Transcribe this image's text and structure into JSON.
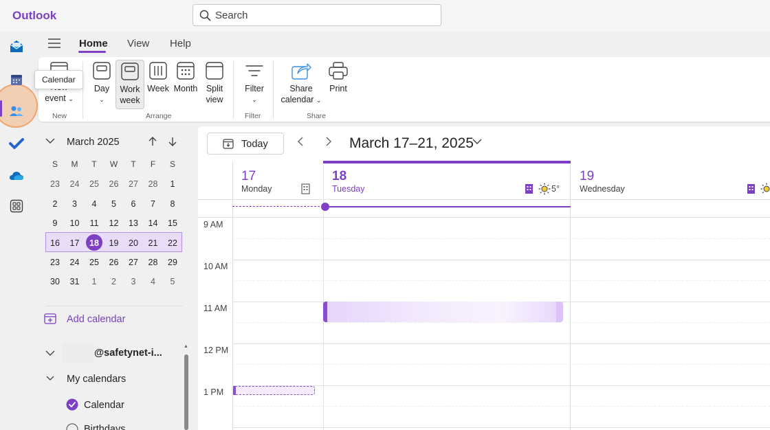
{
  "app": {
    "title": "Outlook"
  },
  "search": {
    "placeholder": "Search"
  },
  "rail": {
    "items": [
      "mail-icon",
      "calendar-icon",
      "people-icon",
      "todo-icon",
      "onedrive-icon",
      "apps-icon"
    ],
    "tooltip": "Calendar"
  },
  "tabs": {
    "home": "Home",
    "view": "View",
    "help": "Help"
  },
  "ribbon": {
    "new_event_line1": "New",
    "new_event_line2": "event",
    "group_new": "New",
    "day": "Day",
    "work_week_line1": "Work",
    "work_week_line2": "week",
    "week": "Week",
    "month": "Month",
    "split_view_line1": "Split",
    "split_view_line2": "view",
    "group_arrange": "Arrange",
    "filter": "Filter",
    "group_filter": "Filter",
    "share_calendar_line1": "Share",
    "share_calendar_line2": "calendar",
    "print": "Print",
    "group_share": "Share"
  },
  "mini_calendar": {
    "title": "March 2025",
    "days_of_week": [
      "S",
      "M",
      "T",
      "W",
      "T",
      "F",
      "S"
    ],
    "weeks": [
      [
        "23",
        "24",
        "25",
        "26",
        "27",
        "28",
        "1"
      ],
      [
        "2",
        "3",
        "4",
        "5",
        "6",
        "7",
        "8"
      ],
      [
        "9",
        "10",
        "11",
        "12",
        "13",
        "14",
        "15"
      ],
      [
        "16",
        "17",
        "18",
        "19",
        "20",
        "21",
        "22"
      ],
      [
        "23",
        "24",
        "25",
        "26",
        "27",
        "28",
        "29"
      ],
      [
        "30",
        "31",
        "1",
        "2",
        "3",
        "4",
        "5"
      ]
    ],
    "today": "18"
  },
  "sidebar": {
    "add_calendar": "Add calendar",
    "account_suffix": "@safetynet-i...",
    "my_calendars": "My calendars",
    "calendar_item": "Calendar",
    "birthdays_item": "Birthdays"
  },
  "main": {
    "today_label": "Today",
    "range_title": "March 17–21, 2025",
    "days": [
      {
        "num": "17",
        "name": "Monday"
      },
      {
        "num": "18",
        "name": "Tuesday",
        "weather": "5°"
      },
      {
        "num": "19",
        "name": "Wednesday"
      }
    ],
    "hours": [
      "9 AM",
      "10 AM",
      "11 AM",
      "12 PM",
      "1 PM"
    ]
  },
  "colors": {
    "accent": "#7d3fc4",
    "event_fill": "#efe3fc"
  }
}
